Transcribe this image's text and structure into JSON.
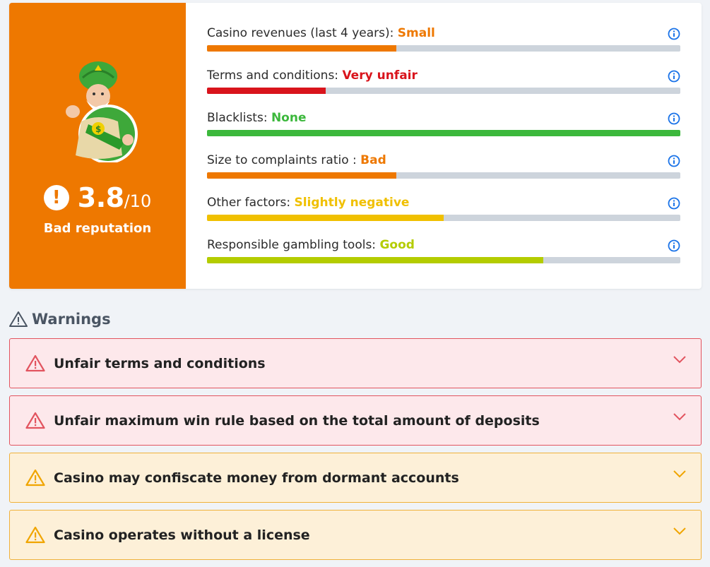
{
  "score": {
    "value": "3.8",
    "max": "/10",
    "label": "Bad reputation",
    "icon": "exclamation-icon",
    "color": "#ee7800"
  },
  "metrics": [
    {
      "label": "Casino revenues (last 4 years): ",
      "value": "Small",
      "color": "#ee7800",
      "fill": 0.4
    },
    {
      "label": "Terms and conditions: ",
      "value": "Very unfair",
      "color": "#d9141c",
      "fill": 0.25
    },
    {
      "label": "Blacklists: ",
      "value": "None",
      "color": "#3cb83c",
      "fill": 1.0
    },
    {
      "label": "Size to complaints ratio : ",
      "value": "Bad",
      "color": "#ee7800",
      "fill": 0.4
    },
    {
      "label": "Other factors: ",
      "value": "Slightly negative",
      "color": "#f0c000",
      "fill": 0.5
    },
    {
      "label": "Responsible gambling tools: ",
      "value": "Good",
      "color": "#b4cc00",
      "fill": 0.71
    }
  ],
  "warnings": {
    "heading": "Warnings",
    "items": [
      {
        "text": "Unfair terms and conditions",
        "level": "danger"
      },
      {
        "text": "Unfair maximum win rule based on the total amount of deposits",
        "level": "danger"
      },
      {
        "text": "Casino may confiscate money from dormant accounts",
        "level": "caution"
      },
      {
        "text": "Casino operates without a license",
        "level": "caution"
      }
    ]
  },
  "colors": {
    "danger": "#e2545f",
    "caution": "#f0b13a",
    "info": "#1a73e8"
  }
}
